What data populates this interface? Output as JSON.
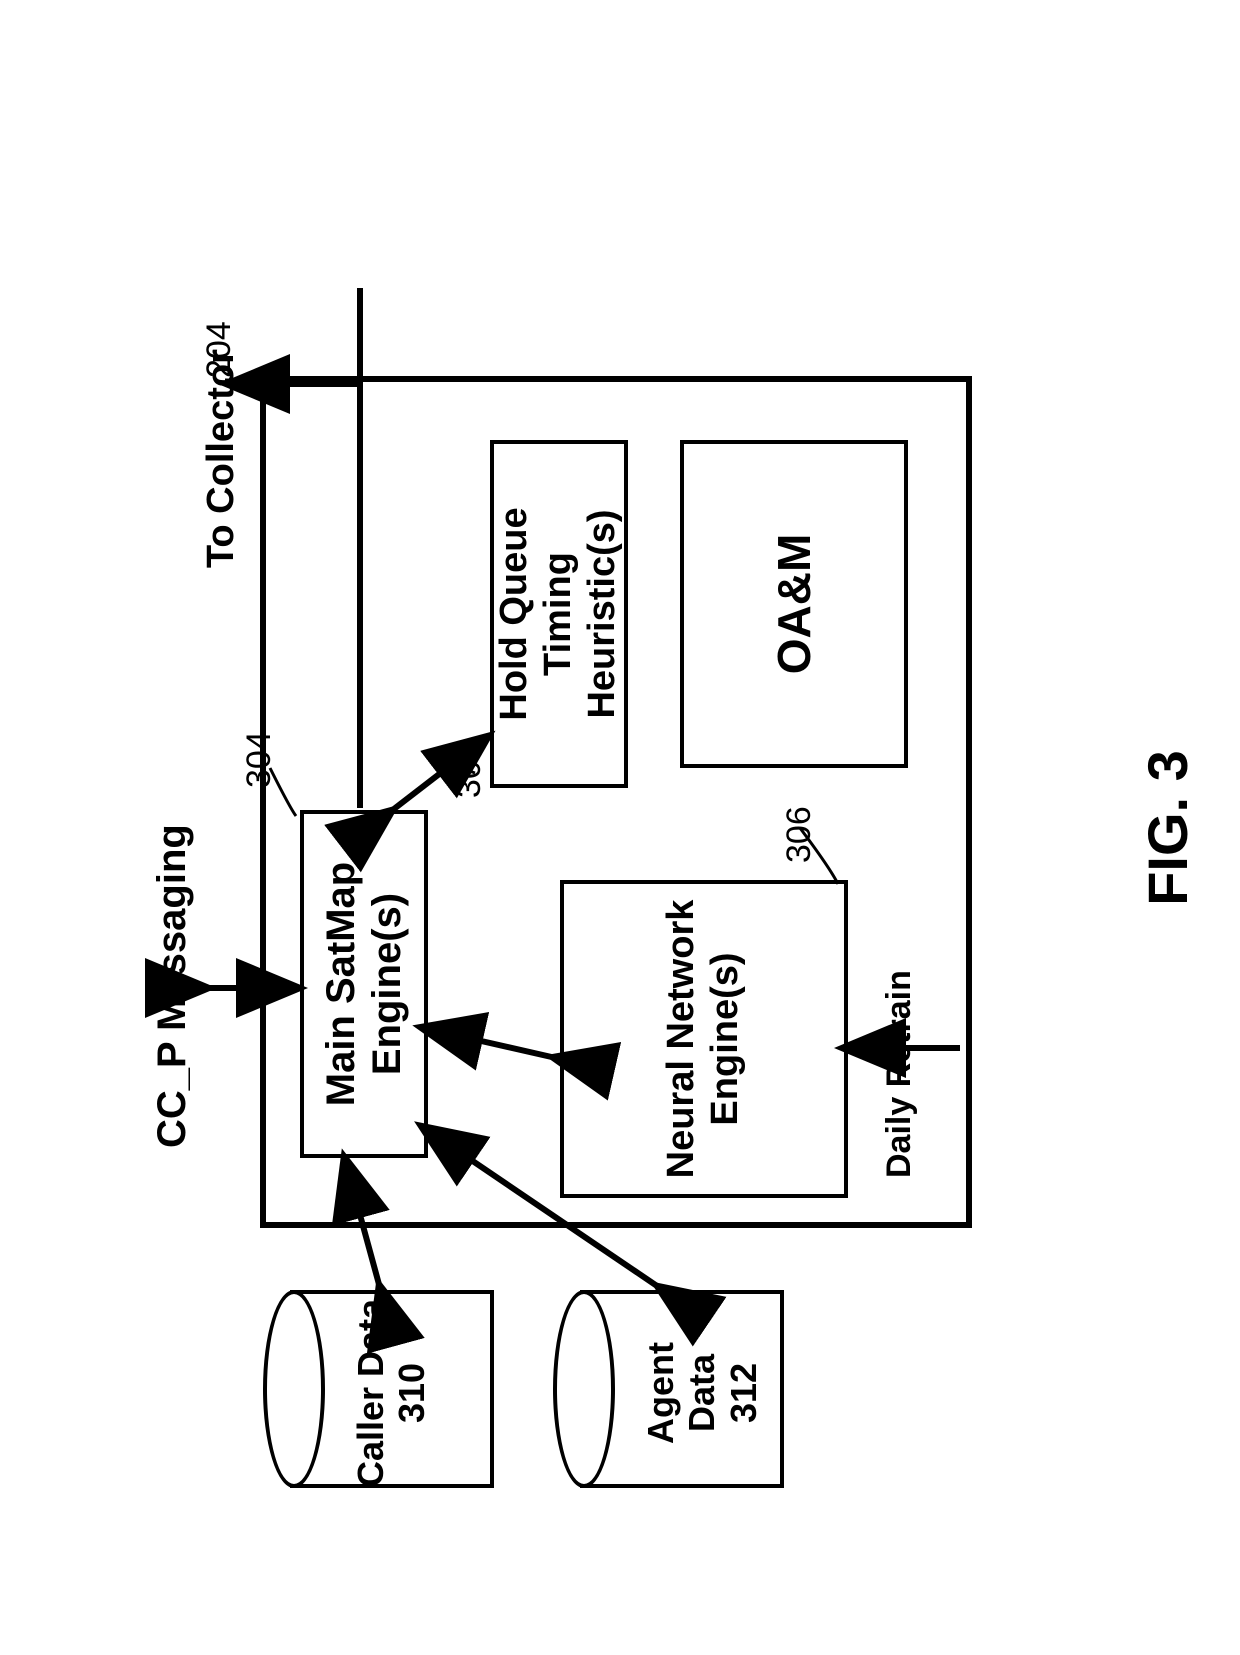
{
  "figure_label": "FIG. 3",
  "refs": {
    "container": "204",
    "satmap": "304",
    "nn": "306",
    "hq": "308",
    "caller": "310",
    "agent": "312"
  },
  "labels": {
    "ccp_messaging": "CC_P Messaging",
    "to_collector": "To Collector",
    "daily_retrain": "Daily Retrain",
    "main_satmap": "Main SatMap Engine(s)",
    "neural_network": "Neural Network Engine(s)",
    "hold_queue": "Hold Queue Timing Heuristic(s)",
    "oam": "OA&M",
    "caller_data": "Caller Data",
    "agent_data": "Agent Data"
  }
}
